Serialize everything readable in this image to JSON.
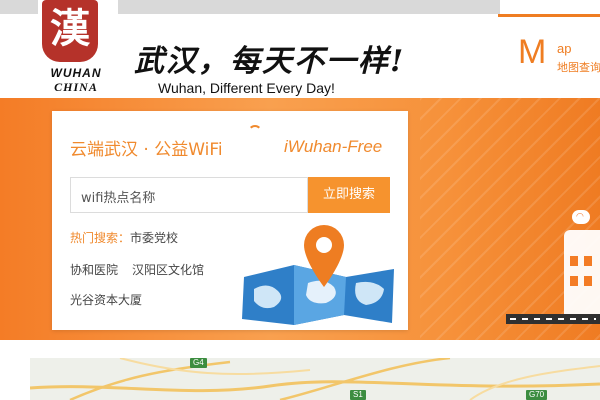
{
  "header": {
    "logo": {
      "mark": "漢",
      "line1": "WUHAN",
      "line2": "CHINA"
    },
    "slogan_cn": "武汉，每天不一样!",
    "slogan_en": "Wuhan, Different Every Day!"
  },
  "map_tab": {
    "letter": "M",
    "rest": "ap",
    "cn": "地图查询"
  },
  "wifi_card": {
    "title": "云端武汉 · 公益WiFi",
    "tagline": "iWuhan-Free",
    "search": {
      "value": "wifi热点名称",
      "button": "立即搜索"
    },
    "hot_label": "热门搜索：",
    "hot_items": [
      "市委党校",
      "协和医院",
      "汉阳区文化馆",
      "光谷资本大厦"
    ]
  },
  "map_strip": {
    "road_signs": [
      "G4",
      "S1",
      "G70"
    ]
  },
  "colors": {
    "accent": "#ef7d22",
    "button": "#f6932e",
    "logo_red": "#b5322a",
    "banner_start": "#f47c26",
    "banner_mid": "#f9a04f"
  }
}
